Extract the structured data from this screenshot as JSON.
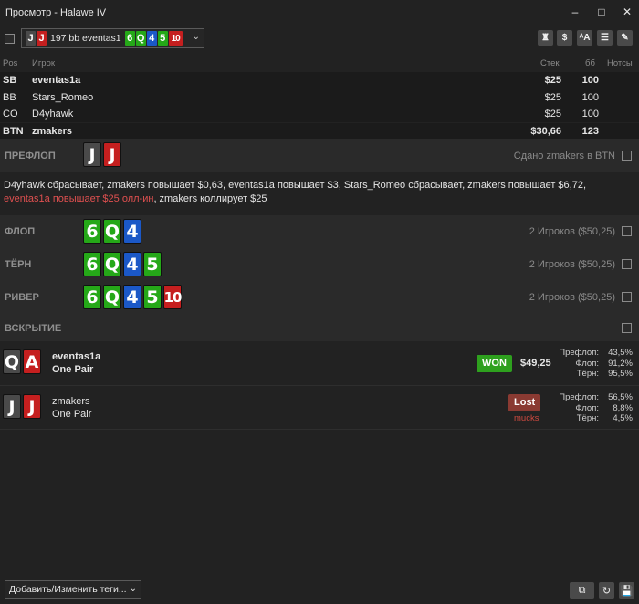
{
  "window": {
    "title": "Просмотр - Halawe IV",
    "minimize": "–",
    "maximize": "□",
    "close": "✕"
  },
  "selector": {
    "hole_cards": [
      {
        "rank": "J",
        "suit": "spades"
      },
      {
        "rank": "J",
        "suit": "hearts"
      }
    ],
    "summary": "197 bb eventas1",
    "board": [
      {
        "rank": "6",
        "suit": "clubs"
      },
      {
        "rank": "Q",
        "suit": "clubs"
      },
      {
        "rank": "4",
        "suit": "diamonds"
      },
      {
        "rank": "5",
        "suit": "clubs"
      },
      {
        "rank": "10",
        "suit": "hearts"
      }
    ],
    "caret": "⌄"
  },
  "toolbar": {
    "icons": [
      "money-bag-icon",
      "dollar-icon",
      "font-size-icon",
      "list-icon",
      "pencil-icon"
    ],
    "dollar": "$",
    "font": "ᴬA",
    "list": "☰",
    "pencil": "✎",
    "bag": "♜"
  },
  "players": {
    "headers": {
      "pos": "Pos",
      "player": "Игрок",
      "stack": "Стек",
      "bb": "бб",
      "notes": "Нотсы"
    },
    "rows": [
      {
        "pos": "SB",
        "name": "eventas1a",
        "stack": "$25",
        "bb": "100",
        "bold": true
      },
      {
        "pos": "BB",
        "name": "Stars_Romeo",
        "stack": "$25",
        "bb": "100",
        "bold": false
      },
      {
        "pos": "CO",
        "name": "D4yhawk",
        "stack": "$25",
        "bb": "100",
        "bold": false
      },
      {
        "pos": "BTN",
        "name": "zmakers",
        "stack": "$30,66",
        "bb": "123",
        "bold": true
      }
    ]
  },
  "preflop": {
    "label": "ПРЕФЛОП",
    "cards": [
      {
        "rank": "J",
        "suit": "spades"
      },
      {
        "rank": "J",
        "suit": "hearts"
      }
    ],
    "dealt": "Сдано zmakers в BTN",
    "actions_normal": "D4yhawk сбрасывает, zmakers повышает $0,63, eventas1a повышает $3, Stars_Romeo сбрасывает, zmakers повышает $6,72, ",
    "actions_allin": "eventas1a повышает $25 олл-ин",
    "actions_tail": ", zmakers коллирует $25"
  },
  "flop": {
    "label": "ФЛОП",
    "cards": [
      {
        "rank": "6",
        "suit": "clubs"
      },
      {
        "rank": "Q",
        "suit": "clubs"
      },
      {
        "rank": "4",
        "suit": "diamonds"
      }
    ],
    "note": "2 Игроков ($50,25)"
  },
  "turn": {
    "label": "ТЁРН",
    "cards": [
      {
        "rank": "6",
        "suit": "clubs"
      },
      {
        "rank": "Q",
        "suit": "clubs"
      },
      {
        "rank": "4",
        "suit": "diamonds"
      },
      {
        "rank": "5",
        "suit": "clubs"
      }
    ],
    "note": "2 Игроков ($50,25)"
  },
  "river": {
    "label": "РИВЕР",
    "cards": [
      {
        "rank": "6",
        "suit": "clubs"
      },
      {
        "rank": "Q",
        "suit": "clubs"
      },
      {
        "rank": "4",
        "suit": "diamonds"
      },
      {
        "rank": "5",
        "suit": "clubs"
      },
      {
        "rank": "10",
        "suit": "hearts"
      }
    ],
    "note": "2 Игроков ($50,25)"
  },
  "showdown": {
    "label": "ВСКРЫТИЕ",
    "players": [
      {
        "cards": [
          {
            "rank": "Q",
            "suit": "spades"
          },
          {
            "rank": "A",
            "suit": "hearts"
          }
        ],
        "name": "eventas1a",
        "hand": "One Pair",
        "result": "WON",
        "amount": "$49,25",
        "equity": [
          {
            "label": "Префлоп:",
            "value": "43,5%"
          },
          {
            "label": "Флоп:",
            "value": "91,2%"
          },
          {
            "label": "Тёрн:",
            "value": "95,5%"
          }
        ]
      },
      {
        "cards": [
          {
            "rank": "J",
            "suit": "spades"
          },
          {
            "rank": "J",
            "suit": "hearts"
          }
        ],
        "name": "zmakers",
        "hand": "One Pair",
        "result": "Lost",
        "note": "mucks",
        "equity": [
          {
            "label": "Префлоп:",
            "value": "56,5%"
          },
          {
            "label": "Флоп:",
            "value": "8,8%"
          },
          {
            "label": "Тёрн:",
            "value": "4,5%"
          }
        ]
      }
    ]
  },
  "footer": {
    "tags_label": "Добавить/Изменить теги...",
    "caret": "⌄",
    "copy": "⧉",
    "refresh": "↻",
    "save": "💾"
  },
  "colors": {
    "hearts": "#c51f1f",
    "spades": "#4a4a4a",
    "clubs": "#25a818",
    "diamonds": "#1b58c7",
    "won": "#2ea01e",
    "lost": "#8a3a32"
  }
}
